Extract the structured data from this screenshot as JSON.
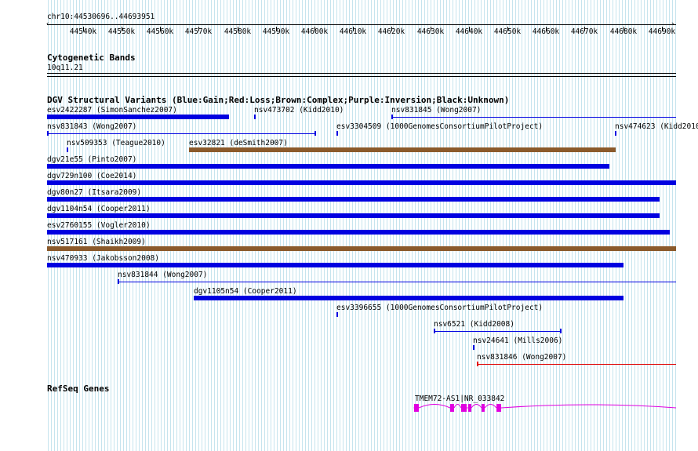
{
  "ruler": {
    "position_label": "chr10:44530696..44693951",
    "ticks": [
      "44540k",
      "44550k",
      "44560k",
      "44570k",
      "44580k",
      "44590k",
      "44600k",
      "44610k",
      "44620k",
      "44630k",
      "44640k",
      "44650k",
      "44660k",
      "44670k",
      "44680k",
      "44690k"
    ]
  },
  "cytobands": {
    "title": "Cytogenetic Bands",
    "band": "10q11.21"
  },
  "dgv": {
    "title": "DGV Structural Variants (Blue:Gain;Red:Loss;Brown:Complex;Purple:Inversion;Black:Unknown)",
    "colors": {
      "gain": "#0000e0",
      "loss": "#e00000",
      "complex": "#8b5a2b",
      "inversion": "#800080",
      "unknown": "#000000"
    },
    "variants": [
      {
        "label": "esv2422287 (SimonSanchez2007)",
        "type": "gain",
        "style": "thick",
        "start": 44530696,
        "end": 44577900
      },
      {
        "label": "nsv473702 (Kidd2010)",
        "type": "gain",
        "style": "mark",
        "start": 44584400,
        "end": 44584800
      },
      {
        "label": "nsv831845 (Wong2007)",
        "type": "gain",
        "style": "thin",
        "start": 44619900,
        "end": 44693951
      },
      {
        "label": "nsv831843 (Wong2007)",
        "type": "gain",
        "style": "thin",
        "start": 44530696,
        "end": 44600500
      },
      {
        "label": "esv3304509 (1000GenomesConsortiumPilotProject)",
        "type": "gain",
        "style": "mark",
        "start": 44605600,
        "end": 44606000
      },
      {
        "label": "nsv474623 (Kidd2010)",
        "type": "gain",
        "style": "mark",
        "start": 44677800,
        "end": 44678200
      },
      {
        "label": "nsv509353 (Teague2010)",
        "type": "gain",
        "style": "mark",
        "start": 44535800,
        "end": 44536200
      },
      {
        "label": "esv32821 (deSmith2007)",
        "type": "complex",
        "style": "thick",
        "start": 44567500,
        "end": 44678100
      },
      {
        "label": "dgv21e55 (Pinto2007)",
        "type": "gain",
        "style": "thick",
        "start": 44530696,
        "end": 44676500
      },
      {
        "label": "dgv729n100 (Coe2014)",
        "type": "gain",
        "style": "thick",
        "start": 44530696,
        "end": 44693951
      },
      {
        "label": "dgv80n27 (Itsara2009)",
        "type": "gain",
        "style": "thick",
        "start": 44530696,
        "end": 44689400
      },
      {
        "label": "dgv1104n54 (Cooper2011)",
        "type": "gain",
        "style": "thick",
        "start": 44530696,
        "end": 44689400
      },
      {
        "label": "esv2760155 (Vogler2010)",
        "type": "gain",
        "style": "thick",
        "start": 44530696,
        "end": 44692000
      },
      {
        "label": "nsv517161 (Shaikh2009)",
        "type": "complex",
        "style": "thick",
        "start": 44530696,
        "end": 44693951
      },
      {
        "label": "nsv470933 (Jakobsson2008)",
        "type": "gain",
        "style": "thick",
        "start": 44530696,
        "end": 44680000
      },
      {
        "label": "nsv831844 (Wong2007)",
        "type": "gain",
        "style": "thin",
        "start": 44549000,
        "end": 44693951
      },
      {
        "label": "dgv1105n54 (Cooper2011)",
        "type": "gain",
        "style": "thick",
        "start": 44568700,
        "end": 44680000
      },
      {
        "label": "esv3396655 (1000GenomesConsortiumPilotProject)",
        "type": "gain",
        "style": "mark",
        "start": 44605600,
        "end": 44606000
      },
      {
        "label": "nsv6521 (Kidd2008)",
        "type": "gain",
        "style": "thin",
        "start": 44630900,
        "end": 44664000
      },
      {
        "label": "nsv24641 (Mills2006)",
        "type": "gain",
        "style": "mark",
        "start": 44641100,
        "end": 44641500
      },
      {
        "label": "nsv831846 (Wong2007)",
        "type": "loss",
        "style": "thin",
        "start": 44642000,
        "end": 44693951
      }
    ]
  },
  "refseq": {
    "title": "RefSeq Genes",
    "gene_label": "TMEM72-AS1|NR_033842",
    "color": "#e000e0",
    "strand": "-",
    "start": 44625800,
    "end": 44693951,
    "exons": [
      {
        "start": 44625900,
        "end": 44627000
      },
      {
        "start": 44635200,
        "end": 44636200
      },
      {
        "start": 44638000,
        "end": 44639400
      },
      {
        "start": 44639900,
        "end": 44640700
      },
      {
        "start": 44643200,
        "end": 44644100
      },
      {
        "start": 44647100,
        "end": 44648300
      }
    ]
  }
}
